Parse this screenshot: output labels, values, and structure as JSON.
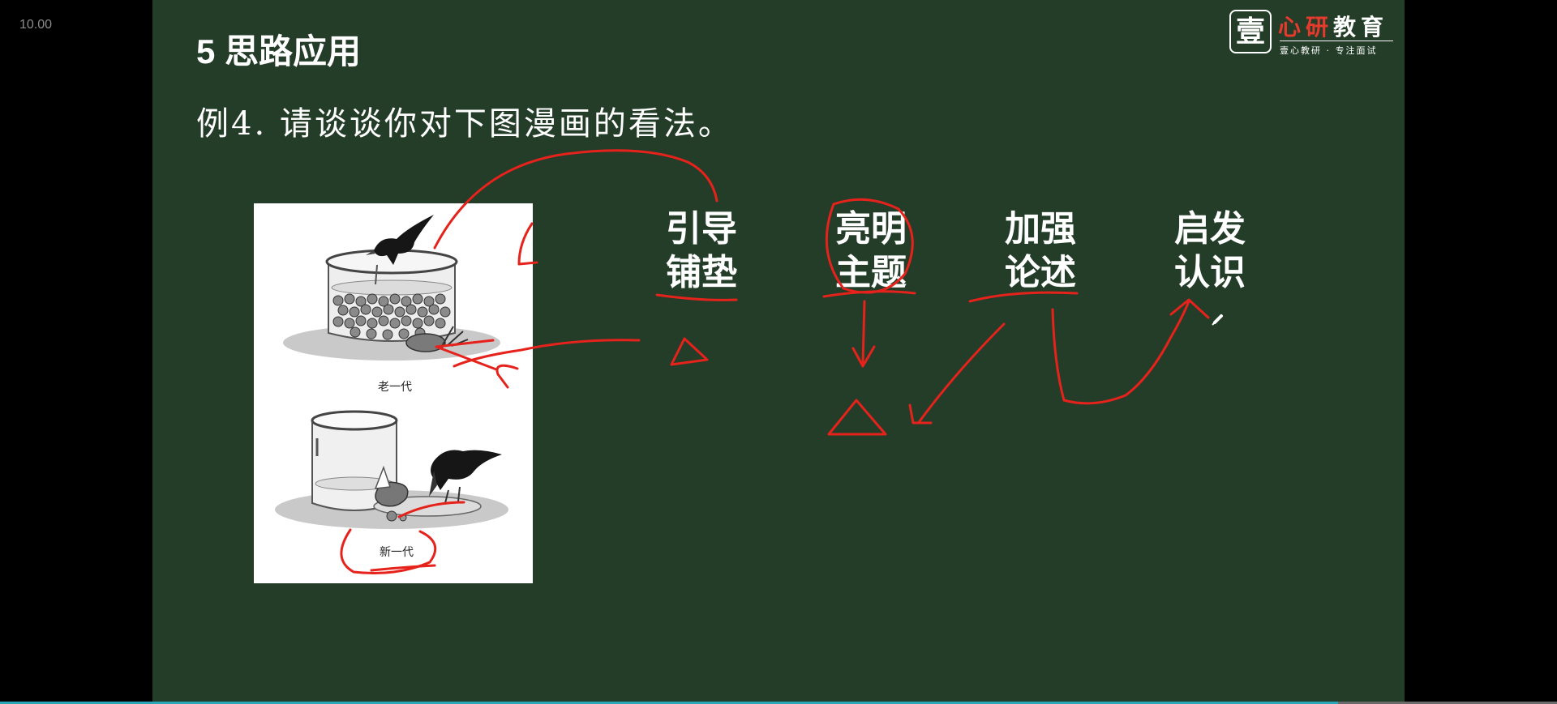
{
  "timestamp": "10.00",
  "slide": {
    "title": "5  思路应用",
    "question": "例4. 请谈谈你对下图漫画的看法。"
  },
  "logo": {
    "badge": "壹",
    "name_red": "心研",
    "name_white": "教育",
    "slogan": "壹心教研 · 专注面试"
  },
  "cartoon": {
    "caption_old": "老一代",
    "caption_new": "新一代"
  },
  "steps": [
    {
      "line1": "引导",
      "line2": "铺垫"
    },
    {
      "line1": "亮明",
      "line2": "主题"
    },
    {
      "line1": "加强",
      "line2": "论述"
    },
    {
      "line1": "启发",
      "line2": "认识"
    }
  ],
  "colors": {
    "slide_background": "#233d28",
    "annotation_red": "#e5221b",
    "text": "#ffffff",
    "progress_bar": "#2aa6b8"
  },
  "icons": [
    "pen-cursor-icon"
  ]
}
